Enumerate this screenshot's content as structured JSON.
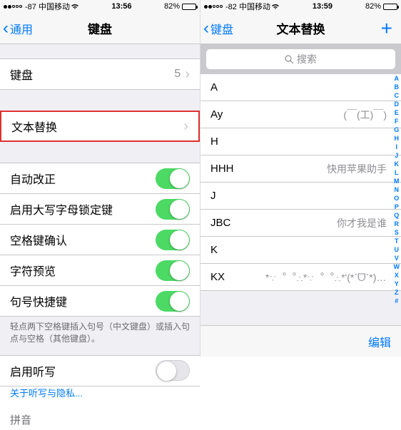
{
  "left": {
    "status": {
      "carrier": "-87 中国移动",
      "time": "13:56",
      "battery": "82%"
    },
    "nav": {
      "back": "通用",
      "title": "键盘"
    },
    "keyboards_row": {
      "label": "键盘",
      "count": "5"
    },
    "text_replace": "文本替换",
    "toggles": {
      "auto_correct": "自动改正",
      "caps_lock": "启用大写字母锁定键",
      "space_confirm": "空格键确认",
      "char_preview": "字符预览",
      "shortcut": "句号快捷键"
    },
    "note": "轻点两下空格键插入句号（中文键盘）或插入句点与空格（其他键盘）。",
    "dictation": "启用听写",
    "dictation_link": "关于听写与隐私...",
    "pinyin": "拼音"
  },
  "right": {
    "status": {
      "carrier": "-82 中国移动",
      "time": "13:59",
      "battery": "82%"
    },
    "nav": {
      "back": "键盘",
      "title": "文本替换"
    },
    "search_placeholder": "搜索",
    "items": [
      {
        "k": "A",
        "v": ""
      },
      {
        "k": "Ay",
        "v": "(￣(工)￣)"
      },
      {
        "k": "H",
        "v": ""
      },
      {
        "k": "HHH",
        "v": "快用苹果助手"
      },
      {
        "k": "J",
        "v": ""
      },
      {
        "k": "JBC",
        "v": "你才我是谁"
      },
      {
        "k": "K",
        "v": ""
      },
      {
        "k": "KX",
        "v": "*∵︒︒∴*∵︒︒∴*'(*ˊᗜˋ*)'*∴︒︒∵*∴︒︒∵*"
      }
    ],
    "index": [
      "A",
      "B",
      "C",
      "D",
      "E",
      "F",
      "G",
      "H",
      "I",
      "J",
      "K",
      "L",
      "M",
      "N",
      "O",
      "P",
      "Q",
      "R",
      "S",
      "T",
      "U",
      "V",
      "W",
      "X",
      "Y",
      "Z",
      "#"
    ],
    "edit": "编辑"
  }
}
